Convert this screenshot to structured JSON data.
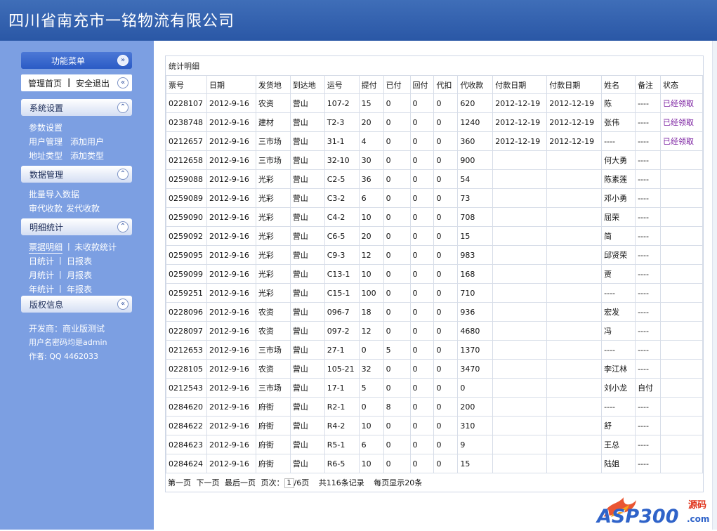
{
  "header": {
    "title": "四川省南充市一铭物流有限公司"
  },
  "sidebar": {
    "menu_label": "功能菜单",
    "nav": {
      "home": "管理首页",
      "separator": "|",
      "logout": "安全退出"
    },
    "system": {
      "title": "系统设置",
      "items": [
        "参数设置",
        "用户管理",
        "添加用户",
        "地址类型",
        "添加类型"
      ]
    },
    "data_mgmt": {
      "title": "数据管理",
      "items": [
        "批量导入数据",
        "审代收款",
        "发代收款"
      ]
    },
    "stats": {
      "title": "明细统计",
      "items": [
        "票据明细",
        "未收款统计",
        "日统计",
        "日报表",
        "月统计",
        "月报表",
        "年统计",
        "年报表"
      ],
      "separator": "|"
    },
    "copyright": {
      "title": "版权信息",
      "lines": [
        "开发商：商业版测试",
        "用户名密码均是admin",
        "作者: QQ 4462033"
      ]
    }
  },
  "main": {
    "section_title": "统计明细",
    "columns": [
      "票号",
      "日期",
      "发货地",
      "到达地",
      "运号",
      "提付",
      "已付",
      "回付",
      "代扣",
      "代收款",
      "付款日期",
      "付款日期",
      "姓名",
      "备注",
      "状态"
    ],
    "rows": [
      [
        "0228107",
        "2012-9-16",
        "农资",
        "营山",
        "107-2",
        "15",
        "0",
        "0",
        "0",
        "620",
        "2012-12-19",
        "2012-12-19",
        "陈",
        "----",
        "已经领取"
      ],
      [
        "0238748",
        "2012-9-16",
        "建材",
        "营山",
        "T2-3",
        "20",
        "0",
        "0",
        "0",
        "1240",
        "2012-12-19",
        "2012-12-19",
        "张伟",
        "----",
        "已经领取"
      ],
      [
        "0212657",
        "2012-9-16",
        "三市场",
        "营山",
        "31-1",
        "4",
        "0",
        "0",
        "0",
        "360",
        "2012-12-19",
        "2012-12-19",
        "----",
        "----",
        "已经领取"
      ],
      [
        "0212658",
        "2012-9-16",
        "三市场",
        "营山",
        "32-10",
        "30",
        "0",
        "0",
        "0",
        "900",
        "",
        "",
        "何大勇",
        "----",
        ""
      ],
      [
        "0259088",
        "2012-9-16",
        "光彩",
        "营山",
        "C2-5",
        "36",
        "0",
        "0",
        "0",
        "54",
        "",
        "",
        "陈素莲",
        "----",
        ""
      ],
      [
        "0259089",
        "2012-9-16",
        "光彩",
        "营山",
        "C3-2",
        "6",
        "0",
        "0",
        "0",
        "73",
        "",
        "",
        "邓小勇",
        "----",
        ""
      ],
      [
        "0259090",
        "2012-9-16",
        "光彩",
        "营山",
        "C4-2",
        "10",
        "0",
        "0",
        "0",
        "708",
        "",
        "",
        "屈荣",
        "----",
        ""
      ],
      [
        "0259092",
        "2012-9-16",
        "光彩",
        "营山",
        "C6-5",
        "20",
        "0",
        "0",
        "0",
        "15",
        "",
        "",
        "简",
        "----",
        ""
      ],
      [
        "0259095",
        "2012-9-16",
        "光彩",
        "营山",
        "C9-3",
        "12",
        "0",
        "0",
        "0",
        "983",
        "",
        "",
        "邱贤荣",
        "----",
        ""
      ],
      [
        "0259099",
        "2012-9-16",
        "光彩",
        "营山",
        "C13-1",
        "10",
        "0",
        "0",
        "0",
        "168",
        "",
        "",
        "贾",
        "----",
        ""
      ],
      [
        "0259251",
        "2012-9-16",
        "光彩",
        "营山",
        "C15-1",
        "100",
        "0",
        "0",
        "0",
        "710",
        "",
        "",
        "----",
        "----",
        ""
      ],
      [
        "0228096",
        "2012-9-16",
        "农资",
        "营山",
        "096-7",
        "18",
        "0",
        "0",
        "0",
        "936",
        "",
        "",
        "宏发",
        "----",
        ""
      ],
      [
        "0228097",
        "2012-9-16",
        "农资",
        "营山",
        "097-2",
        "12",
        "0",
        "0",
        "0",
        "4680",
        "",
        "",
        "冯",
        "----",
        ""
      ],
      [
        "0212653",
        "2012-9-16",
        "三市场",
        "营山",
        "27-1",
        "0",
        "5",
        "0",
        "0",
        "1370",
        "",
        "",
        "----",
        "----",
        ""
      ],
      [
        "0228105",
        "2012-9-16",
        "农资",
        "营山",
        "105-21",
        "32",
        "0",
        "0",
        "0",
        "3470",
        "",
        "",
        "李江林",
        "----",
        ""
      ],
      [
        "0212543",
        "2012-9-16",
        "三市场",
        "营山",
        "17-1",
        "5",
        "0",
        "0",
        "0",
        "0",
        "",
        "",
        "刘小龙",
        "自付",
        ""
      ],
      [
        "0284620",
        "2012-9-16",
        "府街",
        "营山",
        "R2-1",
        "0",
        "8",
        "0",
        "0",
        "200",
        "",
        "",
        "----",
        "----",
        ""
      ],
      [
        "0284622",
        "2012-9-16",
        "府街",
        "营山",
        "R4-2",
        "10",
        "0",
        "0",
        "0",
        "310",
        "",
        "",
        "舒",
        "----",
        ""
      ],
      [
        "0284623",
        "2012-9-16",
        "府街",
        "营山",
        "R5-1",
        "6",
        "0",
        "0",
        "0",
        "9",
        "",
        "",
        "王总",
        "----",
        ""
      ],
      [
        "0284624",
        "2012-9-16",
        "府街",
        "营山",
        "R6-5",
        "10",
        "0",
        "0",
        "0",
        "15",
        "",
        "",
        "陆姐",
        "----",
        ""
      ]
    ],
    "pager": {
      "first": "第一页",
      "next": "下一页",
      "last": "最后一页",
      "page_label": "页次：",
      "page_value": "1",
      "page_total": "/6页",
      "total": "共116条记录",
      "per_page": "每页显示20条"
    }
  },
  "watermark": {
    "text": "ASP300",
    "sub1": "源码",
    "sub2": ".com"
  },
  "colors": {
    "header_bg": "#2a57a6",
    "sidebar_bg": "#7c9fe2",
    "status_link": "#7a1fa0"
  }
}
